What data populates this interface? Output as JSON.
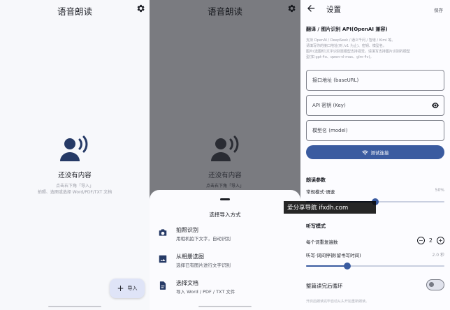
{
  "home": {
    "title": "语音朗读",
    "empty_title": "还没有内容",
    "empty_hint_1": "点击右下角「导入」",
    "empty_hint_2": "拍照、选图或选择 Word/PDF/TXT 文档",
    "fab_label": "导入",
    "fab_icon": "plus-icon"
  },
  "import_sheet": {
    "app_title": "语音朗读",
    "empty_title": "还没有内容",
    "empty_hint": "点击右下角「导入」",
    "title": "选择导入方式",
    "options": [
      {
        "label": "拍照识别",
        "sub": "用相机拍下文字，自动识别",
        "icon": "camera-icon"
      },
      {
        "label": "从相册选图",
        "sub": "选择已有图片进行文字识别",
        "icon": "image-icon"
      },
      {
        "label": "选择文档",
        "sub": "导入 Word / PDF / TXT 文件",
        "icon": "document-icon"
      }
    ]
  },
  "settings": {
    "title": "设置",
    "save_label": "保存",
    "api_section": "翻译 / 图片识别 API(OpenAI 兼容)",
    "api_desc_1": "支持 OpenAI / DeepSeek / 通义千问 / 智谱 / Kimi 等。",
    "api_desc_2": "请填写你的接口地址(到 /v1 为止)、密钥、模型名。",
    "api_desc_3": "图片(选图时)文字识别需模型支持视觉，请填写支持图片识别的模型",
    "api_desc_4": "型(如 gpt-4o、qwen-vl-max、glm-4v)。",
    "base_url_label": "接口地址 (baseURL)",
    "api_key_label": "API 密钥 (Key)",
    "model_label": "模型名 (model)",
    "test_button": "测试连接",
    "reading_section": "朗读参数",
    "speed_label": "常规模式·语速",
    "speed_value": "50%",
    "speed_level": 0.5,
    "dictation_section": "听写模式",
    "repeat_label": "每个词重复遍数",
    "repeat_value": "2",
    "pause_label": "听写·词间停顿(留书写时间)",
    "pause_value": "2.0 秒",
    "pause_level": 0.3,
    "loop_label": "整篇读完后循环",
    "loop_on": false,
    "loop_desc": "开启后朗读完毕自动从头开始重新朗读。"
  },
  "watermark": {
    "text": "爱分享导航  ifxdh.com"
  }
}
